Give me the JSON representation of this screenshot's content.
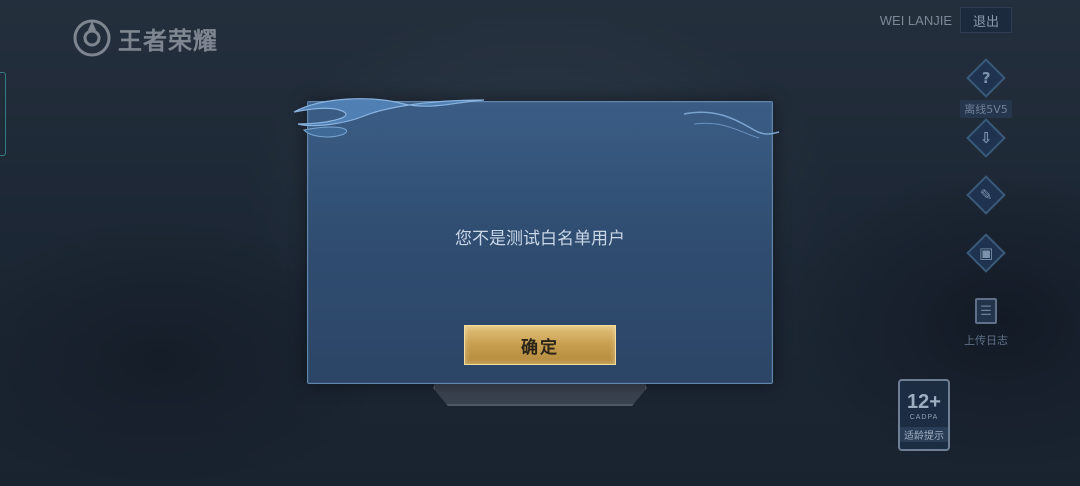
{
  "app": {
    "logo_text": "王者荣耀"
  },
  "account": {
    "username": "WEI LANJIE",
    "logout_label": "退出"
  },
  "side_menu": [
    {
      "icon": "question-icon",
      "glyph": "?",
      "label": "离线5V5"
    },
    {
      "icon": "download-icon",
      "glyph": "⇩",
      "label": ""
    },
    {
      "icon": "repair-icon",
      "glyph": "✎",
      "label": ""
    },
    {
      "icon": "phone-icon",
      "glyph": "▣",
      "label": ""
    },
    {
      "icon": "clipboard-icon",
      "glyph": "☰",
      "label": "上传日志"
    }
  ],
  "age_rating": {
    "number": "12+",
    "org": "CADPA",
    "tip": "适龄提示"
  },
  "dialog": {
    "message": "您不是测试白名单用户",
    "confirm_label": "确定"
  },
  "colors": {
    "dialog_bg": "#304e72",
    "confirm_gold": "#c79d4e",
    "dialog_border": "#5f86ad"
  }
}
